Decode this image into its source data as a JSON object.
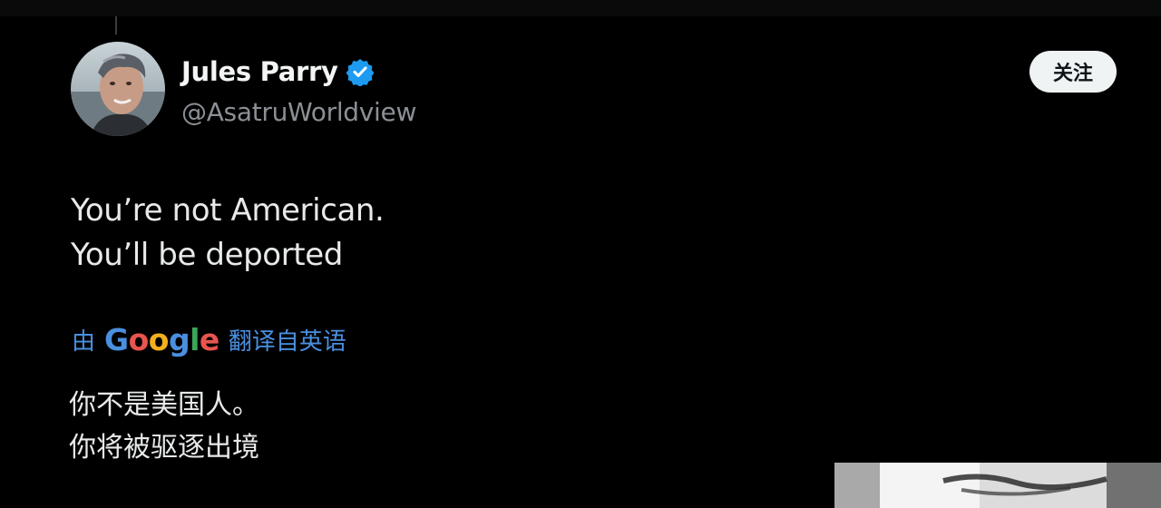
{
  "author": {
    "display_name": "Jules Parry",
    "handle": "@AsatruWorldview",
    "verified": true,
    "avatar": "profile-photo"
  },
  "follow_button": {
    "label": "关注"
  },
  "tweet": {
    "lines": [
      "You’re not American.",
      "You’ll be deported"
    ]
  },
  "translation": {
    "prefix": "由",
    "provider_letters": [
      "G",
      "o",
      "o",
      "g",
      "l",
      "e"
    ],
    "provider_colors": [
      "#4a8fe0",
      "#e8554e",
      "#f2b01e",
      "#4a8fe0",
      "#3aa757",
      "#e8554e"
    ],
    "suffix": "翻译自英语",
    "lines": [
      "你不是美国人。",
      "你将被驱逐出境"
    ]
  },
  "colors": {
    "background": "#000000",
    "text": "#e7e9ea",
    "secondary_text": "#8b9096",
    "link_blue": "#4a8fe0",
    "verified_blue": "#1d9bf0",
    "button_bg": "#eff3f4"
  },
  "icons": {
    "verified": "verified-badge-icon"
  }
}
